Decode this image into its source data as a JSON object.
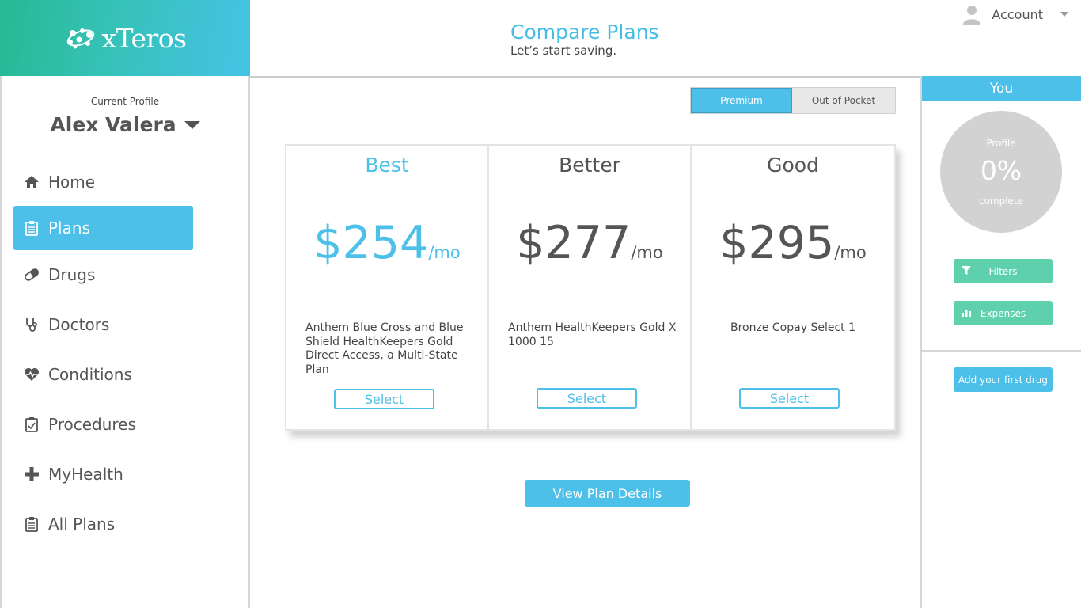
{
  "brand": {
    "name": "xTeros"
  },
  "header": {
    "title": "Compare Plans",
    "subtitle": "Let’s start saving.",
    "account_label": "Account"
  },
  "sidebar": {
    "profile_label": "Current Profile",
    "profile_name": "Alex Valera",
    "items": [
      {
        "label": "Home",
        "icon": "home-icon",
        "active": false
      },
      {
        "label": "Plans",
        "icon": "clipboard-icon",
        "active": true
      },
      {
        "label": "Drugs",
        "icon": "pill-icon",
        "active": false
      },
      {
        "label": "Doctors",
        "icon": "stethoscope-icon",
        "active": false
      },
      {
        "label": "Conditions",
        "icon": "heartbeat-icon",
        "active": false
      },
      {
        "label": "Procedures",
        "icon": "clipboard-outline-icon",
        "active": false
      },
      {
        "label": "MyHealth",
        "icon": "plus-icon",
        "active": false
      },
      {
        "label": "All Plans",
        "icon": "list-clipboard-icon",
        "active": false
      }
    ]
  },
  "toggle": {
    "options": [
      "Premium",
      "Out of Pocket"
    ],
    "selected": "Premium"
  },
  "plans": [
    {
      "tier": "Best",
      "price": "$254",
      "period": "/mo",
      "name": "Anthem Blue Cross and Blue Shield HealthKeepers Gold Direct Access, a Multi-State Plan",
      "select_label": "Select"
    },
    {
      "tier": "Better",
      "price": "$277",
      "period": "/mo",
      "name": "Anthem HealthKeepers Gold X 1000 15",
      "select_label": "Select"
    },
    {
      "tier": "Good",
      "price": "$295",
      "period": "/mo",
      "name": "Bronze Copay Select 1",
      "select_label": "Select"
    }
  ],
  "view_details_label": "View Plan Details",
  "right_panel": {
    "title": "You",
    "progress": {
      "label": "Profile",
      "value": "0%",
      "sub": "complete",
      "fraction": 0
    },
    "filters_label": "Filters",
    "expenses_label": "Expenses",
    "add_drug_label": "Add your first drug"
  },
  "colors": {
    "accent": "#4cc0e8",
    "green": "#5fd0ac",
    "circle": "#d2d2d2"
  }
}
